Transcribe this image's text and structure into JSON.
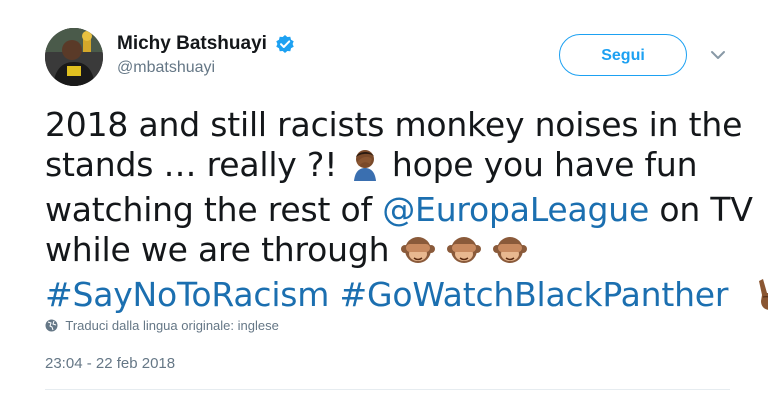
{
  "author": {
    "display_name": "Michy Batshuayi",
    "handle": "@mbatshuayi",
    "verified": true,
    "avatar_icon": "profile-photo"
  },
  "actions": {
    "follow_label": "Segui",
    "menu_icon": "chevron-down-icon"
  },
  "tweet": {
    "line1": "2018 and still racists monkey noises in the",
    "line2_pre": "stands … really ?!",
    "line2_post": "hope you have fun",
    "line3_pre": "watching the rest of",
    "line3_mention": "@EuropaLeague",
    "line3_post": "on TV",
    "line4_pre": "while we are through",
    "hashtag1": "#SayNoToRacism",
    "hashtag2": "#GoWatchBlackPanther",
    "emojis": [
      "facepalm-emoji",
      "see-no-evil-monkey-emoji",
      "see-no-evil-monkey-emoji",
      "see-no-evil-monkey-emoji",
      "victory-hand-emoji"
    ]
  },
  "translate": {
    "label": "Traduci dalla lingua originale: inglese",
    "icon": "globe-icon"
  },
  "timestamp": "23:04 - 22 feb 2018",
  "colors": {
    "link": "#1b6fb0",
    "accent": "#1da1f2",
    "secondary_text": "#657786"
  }
}
